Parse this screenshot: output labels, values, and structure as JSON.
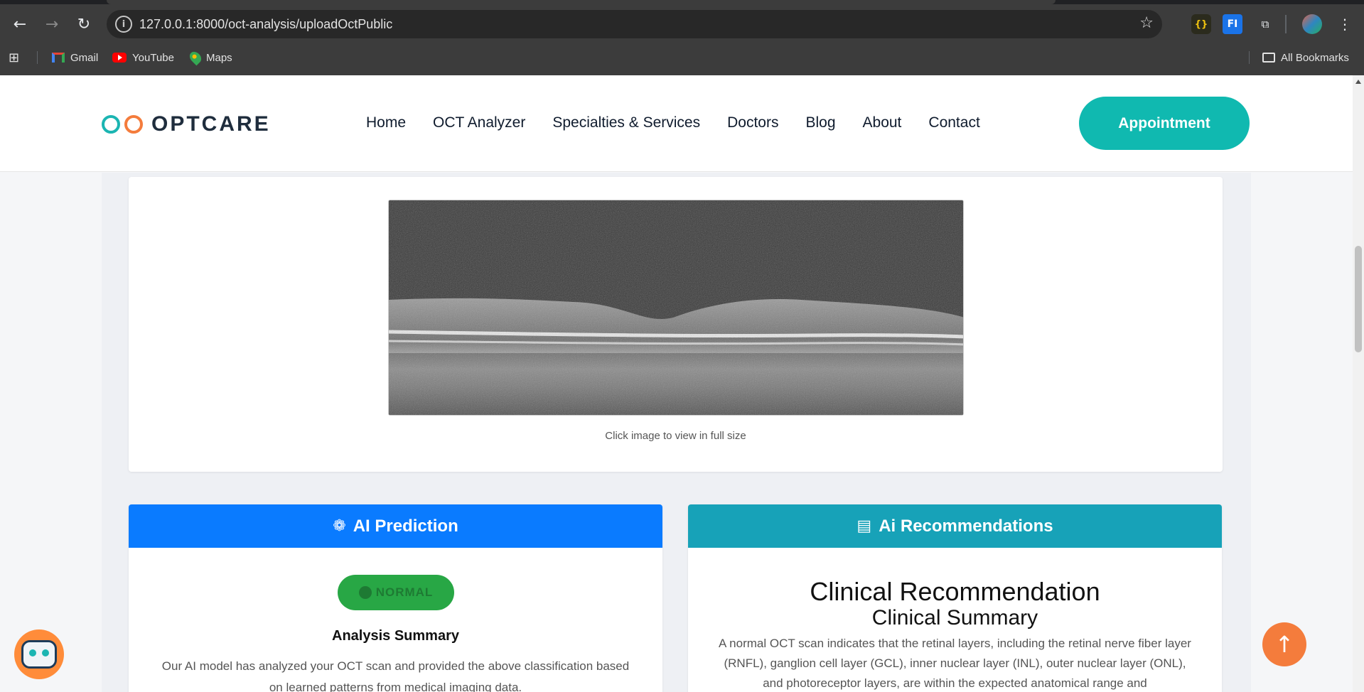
{
  "browser": {
    "url": "127.0.0.1:8000/oct-analysis/uploadOctPublic",
    "bookmarks": [
      {
        "label": "Gmail",
        "icon": "gmail-icon"
      },
      {
        "label": "YouTube",
        "icon": "youtube-icon"
      },
      {
        "label": "Maps",
        "icon": "maps-icon"
      }
    ],
    "all_bookmarks": "All Bookmarks"
  },
  "site": {
    "brand": "OPTCARE",
    "nav": [
      "Home",
      "OCT Analyzer",
      "Specialties & Services",
      "Doctors",
      "Blog",
      "About",
      "Contact"
    ],
    "appointment": "Appointment"
  },
  "image_card": {
    "caption": "Click image to view in full size"
  },
  "prediction": {
    "header": "AI Prediction",
    "badge": "NORMAL",
    "summary_title": "Analysis Summary",
    "summary_text": "Our AI model has analyzed your OCT scan and provided the above classification based on learned patterns from medical imaging data."
  },
  "recommendations": {
    "header": "Ai Recommendations",
    "title": "Clinical Recommendation",
    "subtitle": "Clinical Summary",
    "text": "A normal OCT scan indicates that the retinal layers, including the retinal nerve fiber layer (RNFL), ganglion cell layer (GCL), inner nuclear layer (INL), outer nuclear layer (ONL), and photoreceptor layers, are within the expected anatomical range and"
  },
  "colors": {
    "brand_teal": "#10b9b0",
    "brand_orange": "#f47c3c",
    "prediction_blue": "#0a7bff",
    "recommend_teal": "#17a2b8",
    "normal_green": "#28a745"
  }
}
